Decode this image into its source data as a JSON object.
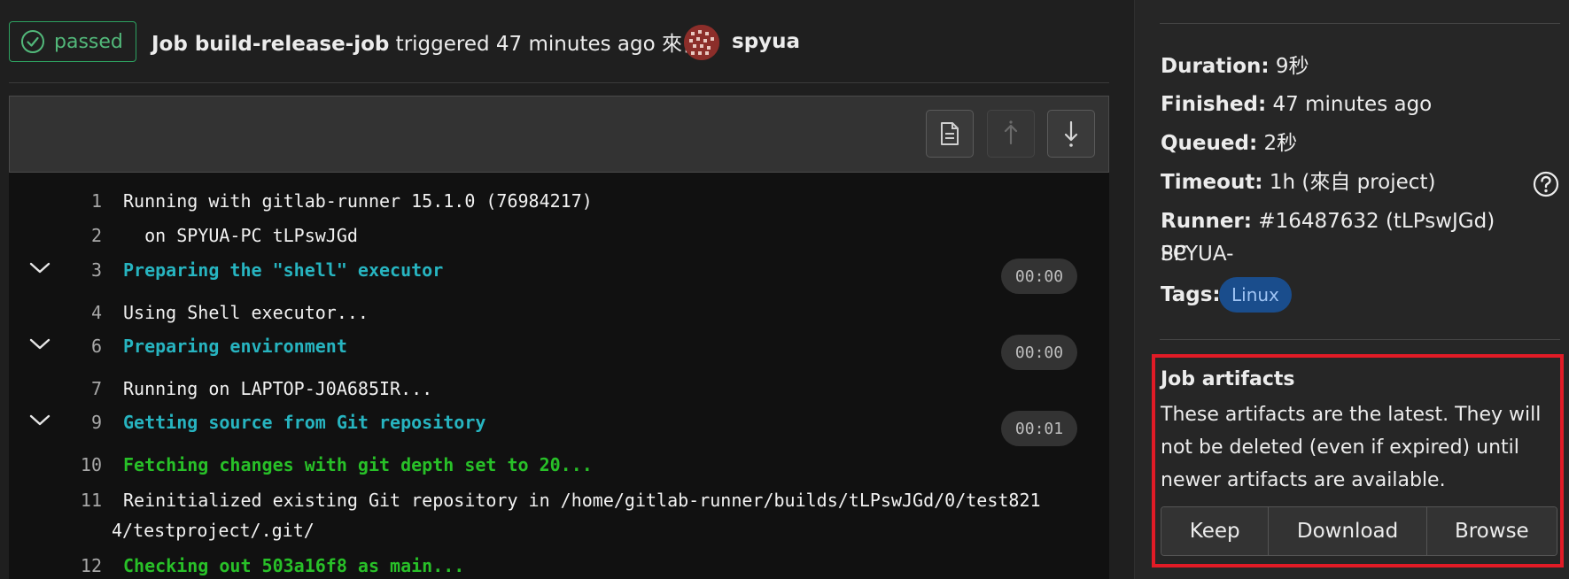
{
  "header": {
    "status": "passed",
    "job_label": "Job build-release-job",
    "triggered_text": " triggered 47 minutes ago 來自",
    "author": "spyua"
  },
  "toolbar": {
    "raw_icon": "document-icon",
    "top_icon": "scroll-top-icon",
    "bottom_icon": "scroll-bottom-icon"
  },
  "log": {
    "lines": [
      {
        "num": "1",
        "text": "Running with gitlab-runner 15.1.0 (76984217)"
      },
      {
        "num": "2",
        "text": "  on SPYUA-PC tLPswJGd"
      },
      {
        "num": "3",
        "text": "Preparing the \"shell\" executor",
        "duration": "00:00"
      },
      {
        "num": "4",
        "text": "Using Shell executor..."
      },
      {
        "num": "6",
        "text": "Preparing environment",
        "duration": "00:00"
      },
      {
        "num": "7",
        "text": "Running on LAPTOP-J0A685IR..."
      },
      {
        "num": "9",
        "text": "Getting source from Git repository",
        "duration": "00:01"
      },
      {
        "num": "10",
        "text": "Fetching changes with git depth set to 20..."
      },
      {
        "num": "11",
        "text": "Reinitialized existing Git repository in /home/gitlab-runner/builds/tLPswJGd/0/test821",
        "text_cont": "4/testproject/.git/"
      },
      {
        "num": "12",
        "text": "Checking out 503a16f8 as main..."
      }
    ]
  },
  "sidebar": {
    "duration_label": "Duration:",
    "duration_value": " 9秒",
    "finished_label": "Finished:",
    "finished_value": " 47 minutes ago",
    "queued_label": "Queued:",
    "queued_value": " 2秒",
    "timeout_label": "Timeout:",
    "timeout_value": " 1h (來自 project)",
    "runner_label": "Runner:",
    "runner_value": " #16487632 (tLPswJGd) SPYUA-",
    "runner_value_cont": "PC",
    "tags_label": "Tags:",
    "tag": "Linux",
    "artifacts": {
      "title": "Job artifacts",
      "description": "These artifacts are the latest. They will not be deleted (even if expired) until newer artifacts are available.",
      "keep": "Keep",
      "download": "Download",
      "browse": "Browse"
    }
  },
  "colors": {
    "passed": "#52b87a",
    "section_header": "#27b4c0",
    "git_step": "#28c028",
    "tag_bg": "#1a4d8c",
    "highlight_box": "#e11b26"
  }
}
